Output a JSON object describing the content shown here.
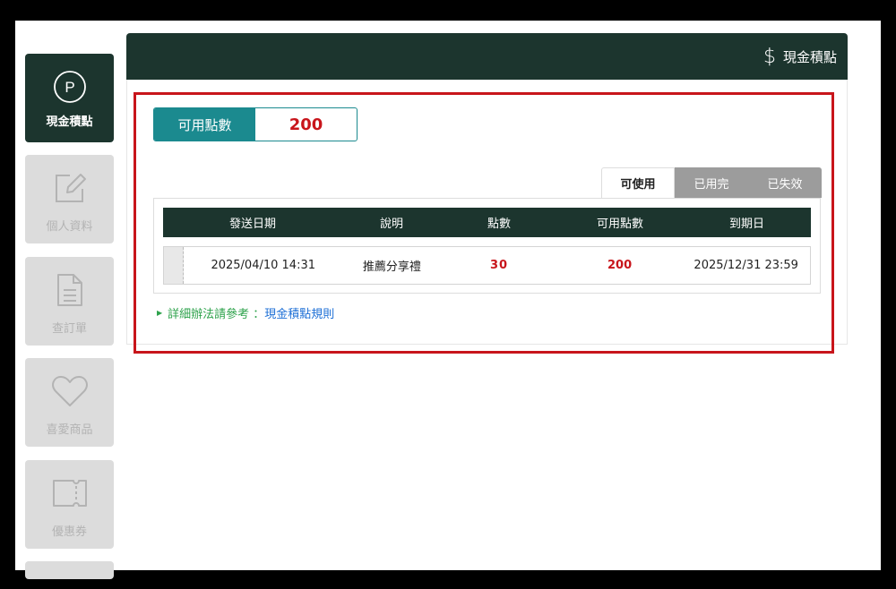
{
  "sidebar": {
    "items": [
      {
        "label": "現金積點",
        "icon": "p-circle-icon",
        "active": true
      },
      {
        "label": "個人資料",
        "icon": "edit-icon",
        "active": false
      },
      {
        "label": "查訂單",
        "icon": "document-icon",
        "active": false
      },
      {
        "label": "喜愛商品",
        "icon": "heart-icon",
        "active": false
      },
      {
        "label": "優惠券",
        "icon": "ticket-icon",
        "active": false
      }
    ],
    "p_letter": "P"
  },
  "header": {
    "title": "現金積點",
    "icon": "dollar-icon",
    "dollar_symbol": "$"
  },
  "available": {
    "label": "可用點數",
    "value": "200"
  },
  "tabs": [
    "可使用",
    "已用完",
    "已失效"
  ],
  "table": {
    "headers": [
      "發送日期",
      "說明",
      "點數",
      "可用點數",
      "到期日"
    ],
    "rows": [
      [
        "2025/04/10 14:31",
        "推薦分享禮",
        "30",
        "200",
        "2025/12/31 23:59"
      ]
    ]
  },
  "rules": {
    "prefix": "詳細辦法請參考 ：",
    "link": "現金積點規則"
  },
  "colors": {
    "dark_green": "#1c352e",
    "teal": "#1b8a8f",
    "red": "#c8151b",
    "link_blue": "#1d6fd6",
    "green": "#2da24b"
  }
}
